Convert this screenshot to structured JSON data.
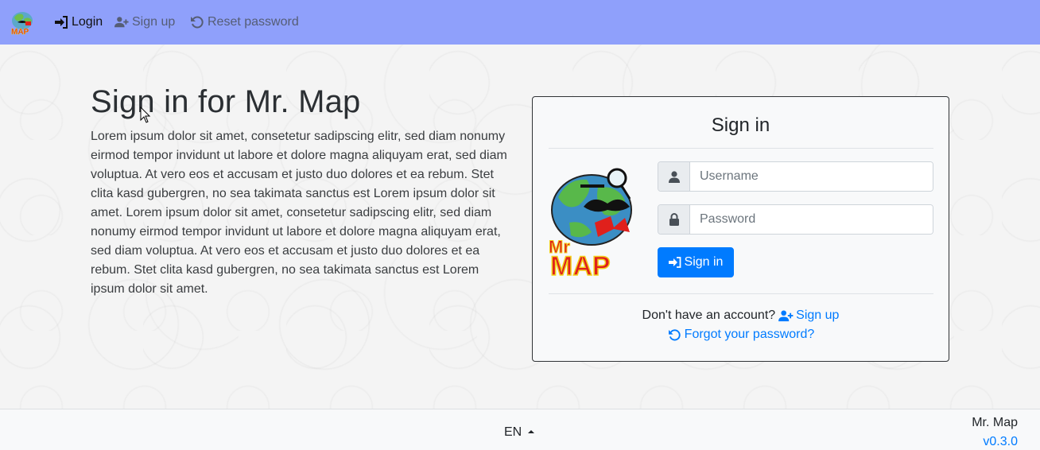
{
  "navbar": {
    "brand_icon": "mr-map-logo",
    "items": [
      {
        "label": "Login",
        "icon": "sign-in-icon"
      },
      {
        "label": "Sign up",
        "icon": "user-plus-icon"
      },
      {
        "label": "Reset password",
        "icon": "undo-icon"
      }
    ],
    "background": "#8fa0fb"
  },
  "main": {
    "title": "Sign in for Mr. Map",
    "lead": "Lorem ipsum dolor sit amet, consetetur sadipscing elitr, sed diam nonumy eirmod tempor invidunt ut labore et dolore magna aliquyam erat, sed diam voluptua. At vero eos et accusam et justo duo dolores et ea rebum. Stet clita kasd gubergren, no sea takimata sanctus est Lorem ipsum dolor sit amet. Lorem ipsum dolor sit amet, consetetur sadipscing elitr, sed diam nonumy eirmod tempor invidunt ut labore et dolore magna aliquyam erat, sed diam voluptua. At vero eos et accusam et justo duo dolores et ea rebum. Stet clita kasd gubergren, no sea takimata sanctus est Lorem ipsum dolor sit amet."
  },
  "signin_card": {
    "title": "Sign in",
    "username": {
      "placeholder": "Username",
      "value": "",
      "icon": "user-icon"
    },
    "password": {
      "placeholder": "Password",
      "value": "",
      "icon": "lock-icon"
    },
    "submit_label": "Sign in",
    "no_account_text": "Don't have an account?",
    "signup_link": "Sign up",
    "forgot_link": "Forgot your password?",
    "accent": "#007bff"
  },
  "footer": {
    "language": "EN",
    "app_name": "Mr. Map",
    "version": "v0.3.0"
  }
}
